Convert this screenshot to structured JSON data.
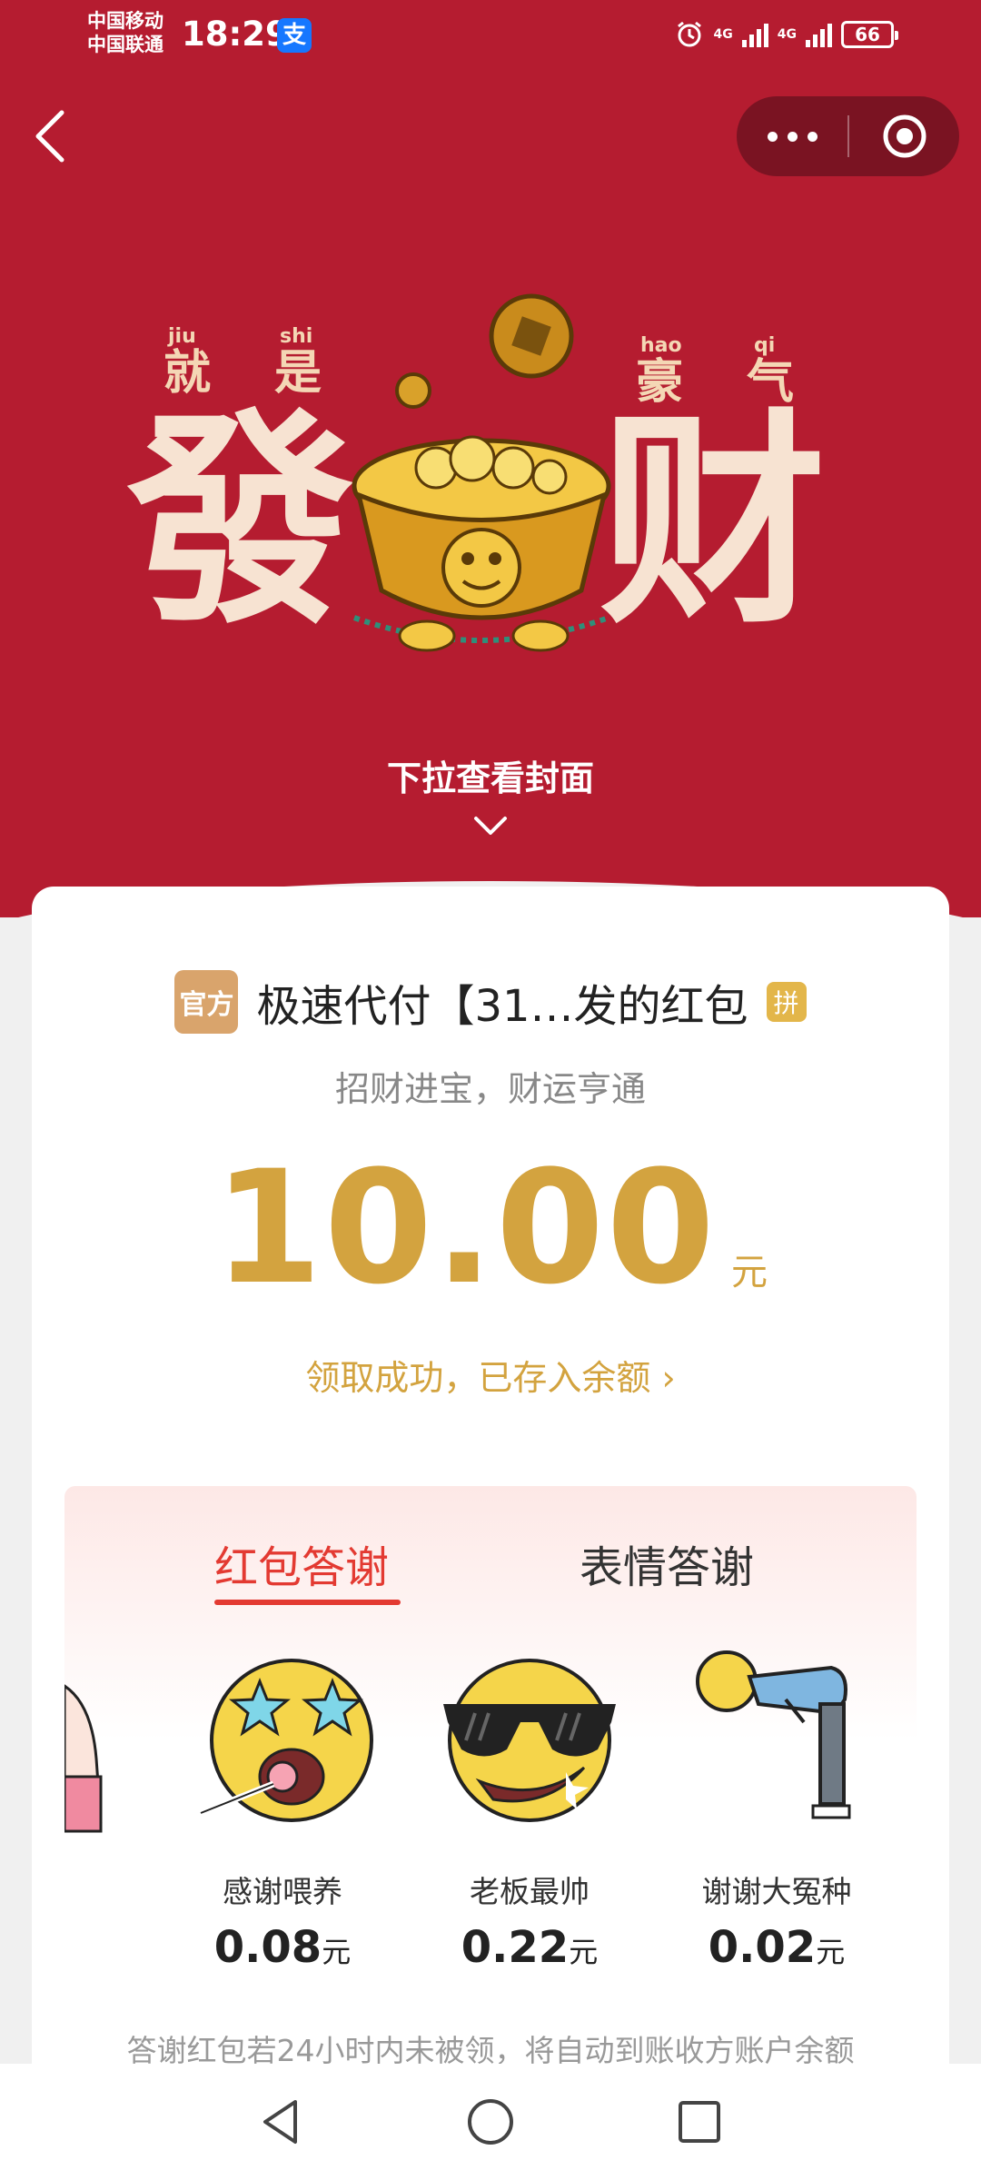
{
  "status_bar": {
    "carrier_1": "中国移动",
    "carrier_2": "中国联通",
    "time": "18:29",
    "alipay_glyph": "支",
    "net_1": "4G",
    "net_2": "4G",
    "battery": "66"
  },
  "header": {
    "back_icon": "chevron-left-icon",
    "more_icon": "more-dots-icon",
    "close_icon": "target-circle-icon"
  },
  "cover": {
    "pinyin": [
      "jiu",
      "shi",
      "hao",
      "qi"
    ],
    "small_chars": [
      "就",
      "是",
      "豪",
      "气"
    ],
    "big_chars": [
      "發",
      "财"
    ],
    "pull_hint": "下拉查看封面"
  },
  "packet": {
    "official_badge": "官方",
    "sender": "极速代付【31…发的红包",
    "pin_badge": "拼",
    "blessing": "招财进宝，财运亨通",
    "amount": "10.00",
    "unit": "元",
    "received_text": "领取成功，已存入余额 ›"
  },
  "thanks": {
    "tabs": [
      {
        "label": "红包答谢",
        "active": true
      },
      {
        "label": "表情答谢",
        "active": false
      }
    ],
    "items": [
      {
        "label": "感谢喂养",
        "amount": "0.08",
        "unit": "元"
      },
      {
        "label": "老板最帅",
        "amount": "0.22",
        "unit": "元"
      },
      {
        "label": "谢谢大冤种",
        "amount": "0.02",
        "unit": "元"
      }
    ],
    "note": "答谢红包若24小时内未被领，将自动到账收方账户余额"
  },
  "colors": {
    "brand_red": "#b51c30",
    "gold": "#d3a33f",
    "tab_red": "#e33a32"
  }
}
